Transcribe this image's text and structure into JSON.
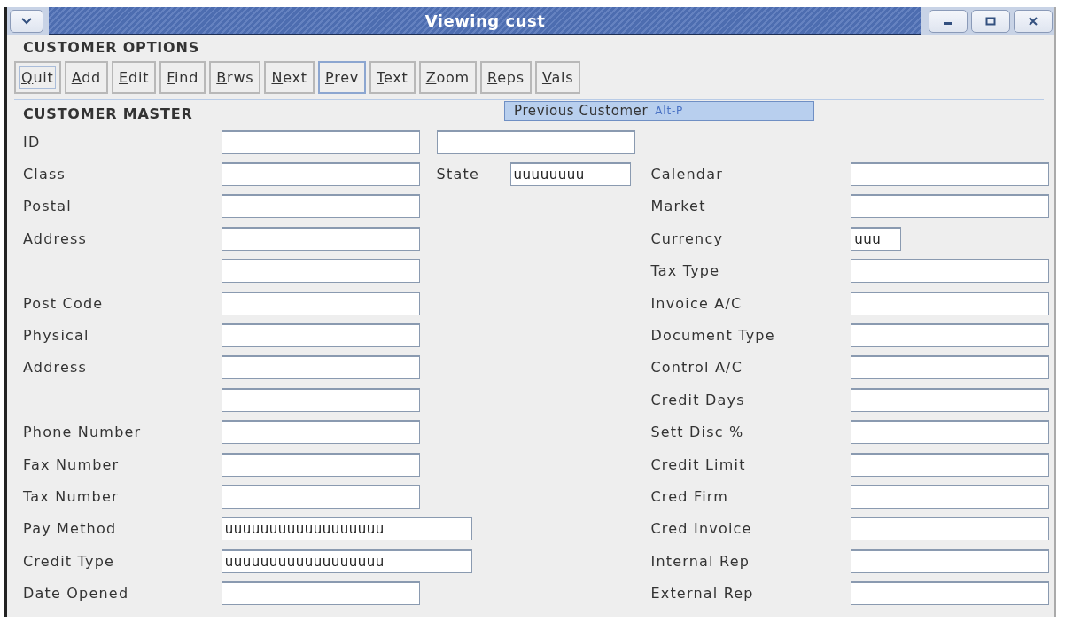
{
  "window": {
    "title": "Viewing cust"
  },
  "options": {
    "heading": "CUSTOMER OPTIONS",
    "buttons": [
      {
        "label": "Quit",
        "focused": true,
        "hovered": false
      },
      {
        "label": "Add",
        "focused": false,
        "hovered": false
      },
      {
        "label": "Edit",
        "focused": false,
        "hovered": false
      },
      {
        "label": "Find",
        "focused": false,
        "hovered": false
      },
      {
        "label": "Brws",
        "focused": false,
        "hovered": false
      },
      {
        "label": "Next",
        "focused": false,
        "hovered": false
      },
      {
        "label": "Prev",
        "focused": false,
        "hovered": true
      },
      {
        "label": "Text",
        "focused": false,
        "hovered": false
      },
      {
        "label": "Zoom",
        "focused": false,
        "hovered": false
      },
      {
        "label": "Reps",
        "focused": false,
        "hovered": false
      },
      {
        "label": "Vals",
        "focused": false,
        "hovered": false
      }
    ]
  },
  "master": {
    "heading": "CUSTOMER MASTER",
    "tooltip": {
      "text": "Previous Customer",
      "shortcut": "Alt-P"
    },
    "rows": [
      {
        "left": {
          "label": "ID",
          "field": {
            "kind": "normal"
          }
        },
        "middle": {
          "field": {
            "kind": "normal"
          }
        }
      },
      {
        "left": {
          "label": "Class",
          "field": {
            "kind": "normal"
          }
        },
        "middle": {
          "label": "State",
          "field": {
            "kind": "short",
            "value": "uuuuuuuu"
          }
        },
        "right": {
          "label": "Calendar",
          "field": {
            "kind": "normal"
          }
        }
      },
      {
        "left": {
          "label": "Postal",
          "field": {
            "kind": "normal"
          }
        },
        "right": {
          "label": "Market",
          "field": {
            "kind": "normal"
          }
        }
      },
      {
        "left": {
          "label": "Address",
          "field": {
            "kind": "normal"
          }
        },
        "right": {
          "label": "Currency",
          "field": {
            "kind": "narrow",
            "value": "uuu"
          }
        }
      },
      {
        "left": {
          "field": {
            "kind": "normal"
          }
        },
        "right": {
          "label": "Tax Type",
          "field": {
            "kind": "normal"
          }
        }
      },
      {
        "left": {
          "label": "Post Code",
          "field": {
            "kind": "normal"
          }
        },
        "right": {
          "label": "Invoice A/C",
          "field": {
            "kind": "normal"
          }
        }
      },
      {
        "left": {
          "label": "Physical",
          "field": {
            "kind": "normal"
          }
        },
        "right": {
          "label": "Document Type",
          "field": {
            "kind": "normal"
          }
        }
      },
      {
        "left": {
          "label": "Address",
          "field": {
            "kind": "normal"
          }
        },
        "right": {
          "label": "Control A/C",
          "field": {
            "kind": "normal"
          }
        }
      },
      {
        "left": {
          "field": {
            "kind": "normal"
          }
        },
        "right": {
          "label": "Credit Days",
          "field": {
            "kind": "normal"
          }
        }
      },
      {
        "left": {
          "label": "Phone Number",
          "field": {
            "kind": "normal"
          }
        },
        "right": {
          "label": "Sett Disc %",
          "field": {
            "kind": "normal"
          }
        }
      },
      {
        "left": {
          "label": "Fax Number",
          "field": {
            "kind": "normal"
          }
        },
        "right": {
          "label": "Credit Limit",
          "field": {
            "kind": "normal"
          }
        }
      },
      {
        "left": {
          "label": "Tax Number",
          "field": {
            "kind": "normal"
          }
        },
        "right": {
          "label": "Cred Firm",
          "field": {
            "kind": "normal"
          }
        }
      },
      {
        "left": {
          "label": "Pay Method",
          "field": {
            "kind": "wide",
            "value": "uuuuuuuuuuuuuuuuuu"
          }
        },
        "right": {
          "label": "Cred Invoice",
          "field": {
            "kind": "normal"
          }
        }
      },
      {
        "left": {
          "label": "Credit Type",
          "field": {
            "kind": "wide",
            "value": "uuuuuuuuuuuuuuuuuu"
          }
        },
        "right": {
          "label": "Internal Rep",
          "field": {
            "kind": "normal"
          }
        }
      },
      {
        "left": {
          "label": "Date Opened",
          "field": {
            "kind": "normal"
          }
        },
        "right": {
          "label": "External Rep",
          "field": {
            "kind": "normal"
          }
        }
      }
    ]
  }
}
